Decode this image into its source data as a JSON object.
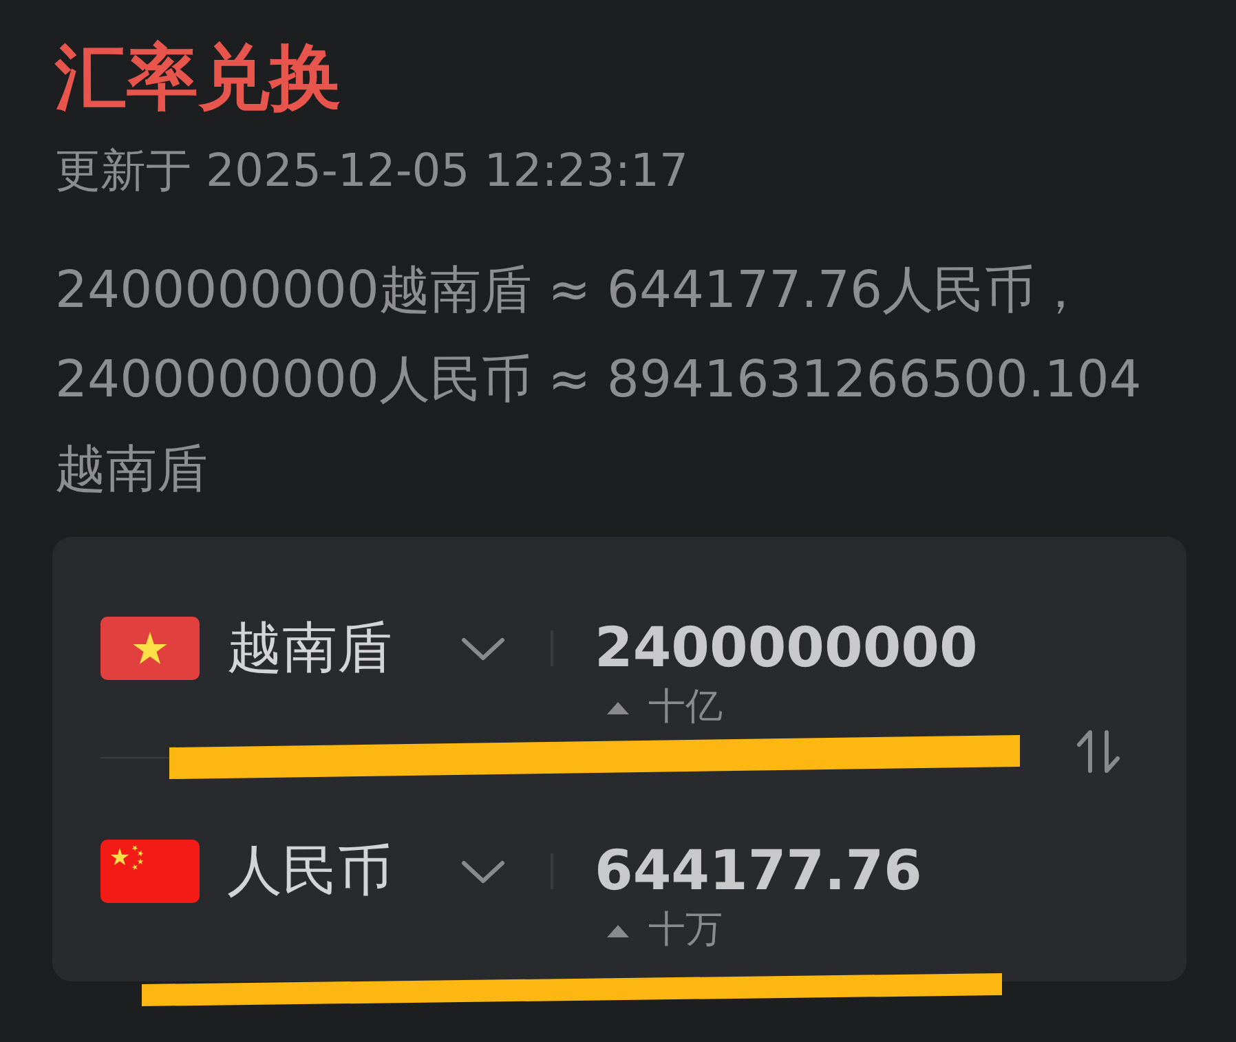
{
  "header": {
    "title": "汇率兑换",
    "updated": "更新于 2025-12-05 12:23:17"
  },
  "summary": "2400000000越南盾 ≈ 644177.76人民币，2400000000人民币 ≈ 8941631266500.104越南盾",
  "converter": {
    "rows": [
      {
        "kind": "vietnam",
        "currency": "越南盾",
        "amount": "2400000000",
        "unit": "十亿"
      },
      {
        "kind": "china",
        "currency": "人民币",
        "amount": "644177.76",
        "unit": "十万"
      }
    ]
  }
}
